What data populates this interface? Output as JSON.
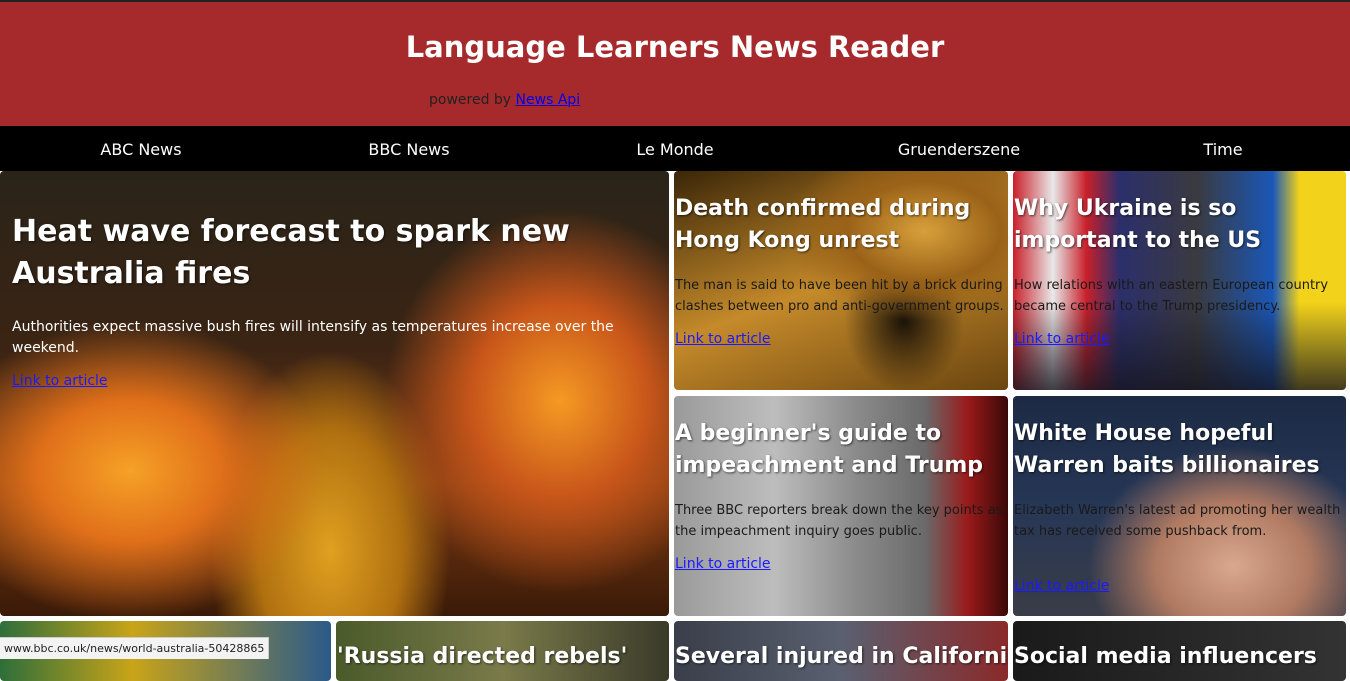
{
  "header": {
    "title": "Language Learners News Reader",
    "powered_by": "powered by",
    "powered_link": "News Api"
  },
  "nav": [
    "ABC News",
    "BBC News",
    "Le Monde",
    "Gruenderszene",
    "Time"
  ],
  "articles": [
    {
      "title": "Heat wave forecast to spark new Australia fires",
      "description": "Authorities expect massive bush fires will intensify as temperatures increase over the weekend.",
      "link": "Link to article"
    },
    {
      "title": "Death confirmed during Hong Kong unrest",
      "description": "The man is said to have been hit by a brick during clashes between pro and anti-government groups.",
      "link": "Link to article"
    },
    {
      "title": "Why Ukraine is so important to the US",
      "description": "How relations with an eastern European country became central to the Trump presidency.",
      "link": "Link to article"
    },
    {
      "title": "A beginner's guide to impeachment and Trump",
      "description": "Three BBC reporters break down the key points as the impeachment inquiry goes public.",
      "link": "Link to article"
    },
    {
      "title": "White House hopeful Warren baits billionaires",
      "description": "Elizabeth Warren's latest ad promoting her wealth tax has received some pushback from.",
      "link": "Link to article"
    },
    {
      "title": "'Russia directed rebels'"
    },
    {
      "title": "Several injured in California"
    },
    {
      "title": "Social media influencers"
    }
  ],
  "status_url": "www.bbc.co.uk/news/world-australia-50428865",
  "colors": {
    "header_bg": "#a6292c",
    "nav_bg": "#000000",
    "link": "#0000ee"
  }
}
